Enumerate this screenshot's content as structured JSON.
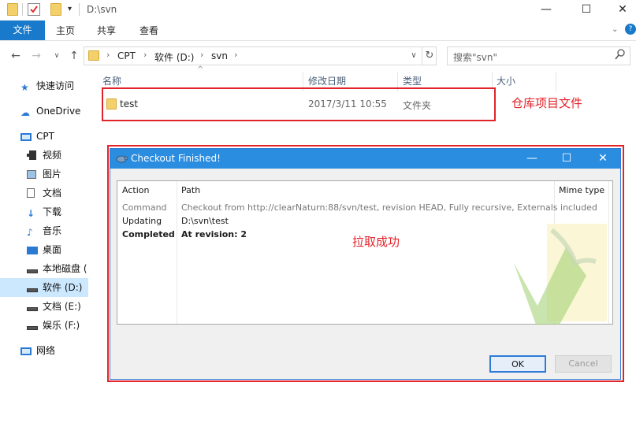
{
  "window": {
    "title": "D:\\svn",
    "controls": {
      "minimize": "—",
      "maximize": "☐",
      "close": "✕"
    }
  },
  "ribbon": {
    "file_tab": "文件",
    "tabs": [
      "主页",
      "共享",
      "查看"
    ]
  },
  "address": {
    "crumbs": [
      "CPT",
      "软件 (D:)",
      "svn"
    ],
    "search_placeholder": "搜索\"svn\""
  },
  "sidebar": {
    "items": [
      {
        "label": "快速访问",
        "icon": "star-icon"
      },
      {
        "label": "OneDrive",
        "icon": "cloud-icon"
      },
      {
        "label": "CPT",
        "icon": "computer-icon"
      },
      {
        "label": "视频",
        "icon": "video-icon"
      },
      {
        "label": "图片",
        "icon": "picture-icon"
      },
      {
        "label": "文档",
        "icon": "document-icon"
      },
      {
        "label": "下载",
        "icon": "download-icon"
      },
      {
        "label": "音乐",
        "icon": "music-icon"
      },
      {
        "label": "桌面",
        "icon": "desktop-icon"
      },
      {
        "label": "本地磁盘 (",
        "icon": "drive-icon"
      },
      {
        "label": "软件 (D:)",
        "icon": "drive-icon",
        "selected": true
      },
      {
        "label": "文档 (E:)",
        "icon": "drive-icon"
      },
      {
        "label": "娱乐 (F:)",
        "icon": "drive-icon"
      },
      {
        "label": "网络",
        "icon": "network-icon"
      }
    ]
  },
  "filelist": {
    "columns": [
      "名称",
      "修改日期",
      "类型",
      "大小"
    ],
    "rows": [
      {
        "name": "test",
        "modified": "2017/3/11 10:55",
        "type": "文件夹",
        "size": ""
      }
    ]
  },
  "annotations": {
    "repo_label": "仓库项目文件",
    "success_label": "拉取成功",
    "color": "#e2232a"
  },
  "dialog": {
    "title": "Checkout Finished!",
    "columns": [
      "Action",
      "Path",
      "Mime type"
    ],
    "rows": [
      {
        "action": "Command",
        "path": "Checkout from http://clearNaturn:88/svn/test, revision HEAD, Fully recursive, Externals included",
        "style": "muted"
      },
      {
        "action": "Updating",
        "path": "D:\\svn\\test",
        "style": "normal"
      },
      {
        "action": "Completed",
        "path": "At revision: 2",
        "style": "bold"
      }
    ],
    "ok_label": "OK",
    "cancel_label": "Cancel"
  },
  "colors": {
    "accent": "#1979ca",
    "dialog_title": "#2b8de0",
    "selection": "#cce8ff"
  }
}
